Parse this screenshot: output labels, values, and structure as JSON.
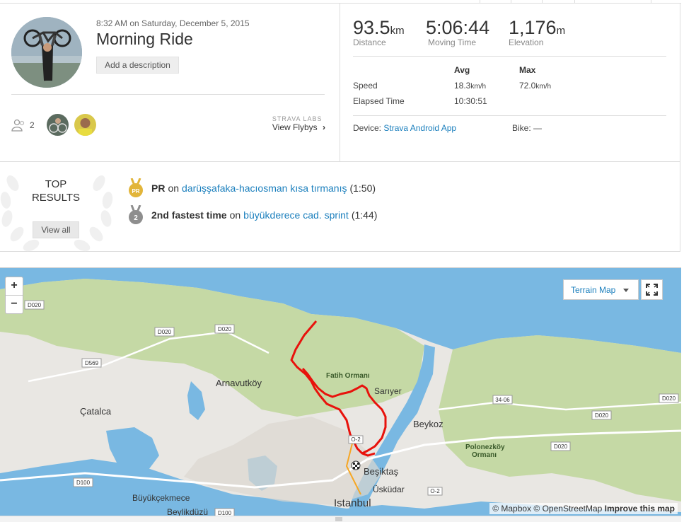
{
  "activity": {
    "date": "8:32 AM on Saturday, December 5, 2015",
    "title": "Morning Ride",
    "add_description": "Add a description",
    "kudos_count": "2",
    "labs_label": "STRAVA LABS",
    "view_flybys": "View Flybys"
  },
  "stats": {
    "distance": {
      "value": "93.5",
      "unit": "km",
      "label": "Distance"
    },
    "moving_time": {
      "value": "5:06:44",
      "label": "Moving Time"
    },
    "elevation": {
      "value": "1,176",
      "unit": "m",
      "label": "Elevation"
    }
  },
  "details": {
    "avg_header": "Avg",
    "max_header": "Max",
    "speed_label": "Speed",
    "speed_avg": "18.3",
    "speed_max": "72.0",
    "speed_unit": "km/h",
    "elapsed_label": "Elapsed Time",
    "elapsed_value": "10:30:51",
    "device_label": "Device:",
    "device_value": "Strava Android App",
    "bike_label": "Bike:",
    "bike_value": "—"
  },
  "results": {
    "title_line1": "TOP",
    "title_line2": "RESULTS",
    "view_all": "View all",
    "items": [
      {
        "badge": "PR",
        "achievement": "PR",
        "on": "on",
        "segment": "darüşşafaka-hacıosman kısa tırmanış",
        "time": "(1:50)",
        "medal_color": "#e2b53a"
      },
      {
        "badge": "2",
        "achievement": "2nd fastest time",
        "on": "on",
        "segment": "büyükderece cad. sprint",
        "time": "(1:44)",
        "medal_color": "#8e8e8e"
      }
    ]
  },
  "map": {
    "zoom_in": "+",
    "zoom_out": "−",
    "layer": "Terrain Map",
    "attribution_mapbox": "© Mapbox",
    "attribution_osm": "© OpenStreetMap",
    "improve": "Improve this map",
    "labels": {
      "arnavutkoy": "Arnavutköy",
      "catalca": "Çatalca",
      "fatih_ormani": "Fatih Ormanı",
      "sariyer": "Sarıyer",
      "beykoz": "Beykoz",
      "besiktas": "Beşiktaş",
      "uskudar": "Üsküdar",
      "istanbul": "Istanbul",
      "buyukcekmece": "Büyükçekmece",
      "beylikduzu": "Beylikdüzü",
      "polonezkoy1": "Polonezköy",
      "polonezkoy2": "Ormanı"
    },
    "roads": {
      "d020": "D020",
      "d569": "D569",
      "d100": "D100",
      "o2": "O-2",
      "r3406": "34-06"
    }
  },
  "colors": {
    "link": "#1b7fbd",
    "route": "#e8120c",
    "water": "#79b8e2",
    "land": "#e9e7e3",
    "forest": "#c5d9a5"
  }
}
